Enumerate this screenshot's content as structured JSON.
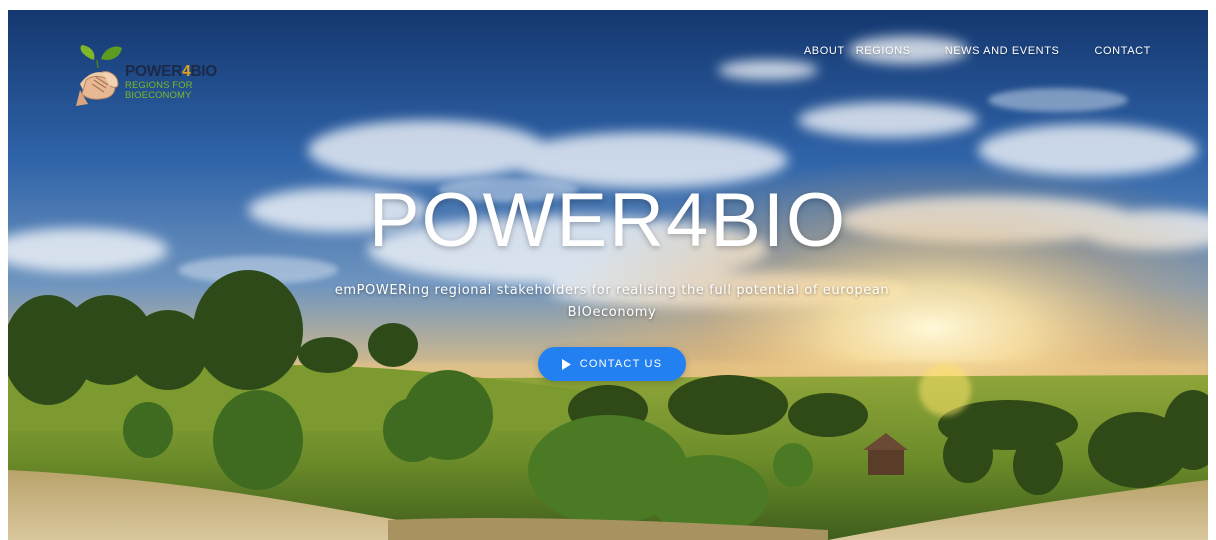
{
  "brand": {
    "name_main": "POWER",
    "name_accent": "4",
    "name_end": "BIO",
    "tagline_line1": "REGIONS FOR",
    "tagline_line2": "BIOECONOMY",
    "icon": "handshake-leaf-logo"
  },
  "nav": {
    "items": [
      {
        "label": "ABOUT"
      },
      {
        "label": "REGIONS"
      },
      {
        "label": "NEWS AND EVENTS"
      },
      {
        "label": "CONTACT"
      }
    ]
  },
  "hero": {
    "title": "POWER4BIO",
    "subtitle": "emPOWERing regional stakeholders for realising the full potential of european BIOeconomy",
    "background": "countryside-sunset-landscape",
    "cta": {
      "label": "CONTACT US",
      "icon": "play-icon"
    }
  },
  "colors": {
    "cta": "#2380f0",
    "brand_accent": "#e2a31b",
    "tagline": "#7eb829"
  }
}
